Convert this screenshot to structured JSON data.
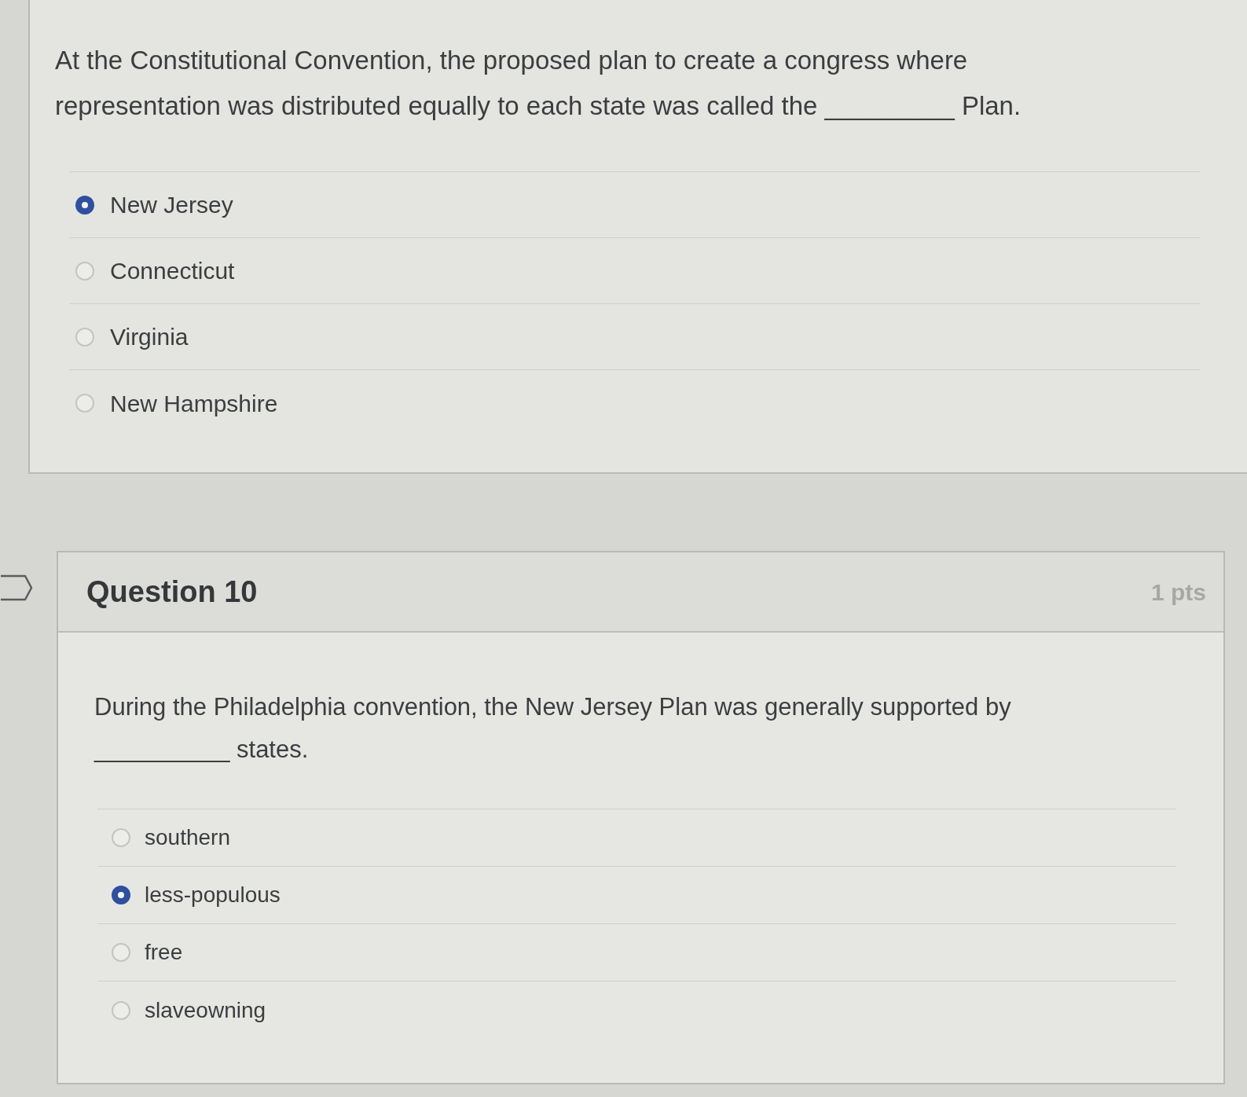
{
  "questions": [
    {
      "text_lines": [
        "At the Constitutional Convention, the proposed plan to create a congress where",
        "representation was distributed equally to each state was called the _________ Plan."
      ],
      "options": [
        {
          "label": "New Jersey",
          "selected": true
        },
        {
          "label": "Connecticut",
          "selected": false
        },
        {
          "label": "Virginia",
          "selected": false
        },
        {
          "label": "New Hampshire",
          "selected": false
        }
      ]
    },
    {
      "title": "Question 10",
      "points": "1 pts",
      "flagged": false,
      "text_lines": [
        "During the Philadelphia convention, the New Jersey Plan was generally supported by",
        "__________ states."
      ],
      "options": [
        {
          "label": "southern",
          "selected": false
        },
        {
          "label": "less-populous",
          "selected": true
        },
        {
          "label": "free",
          "selected": false
        },
        {
          "label": "slaveowning",
          "selected": false
        }
      ]
    }
  ]
}
